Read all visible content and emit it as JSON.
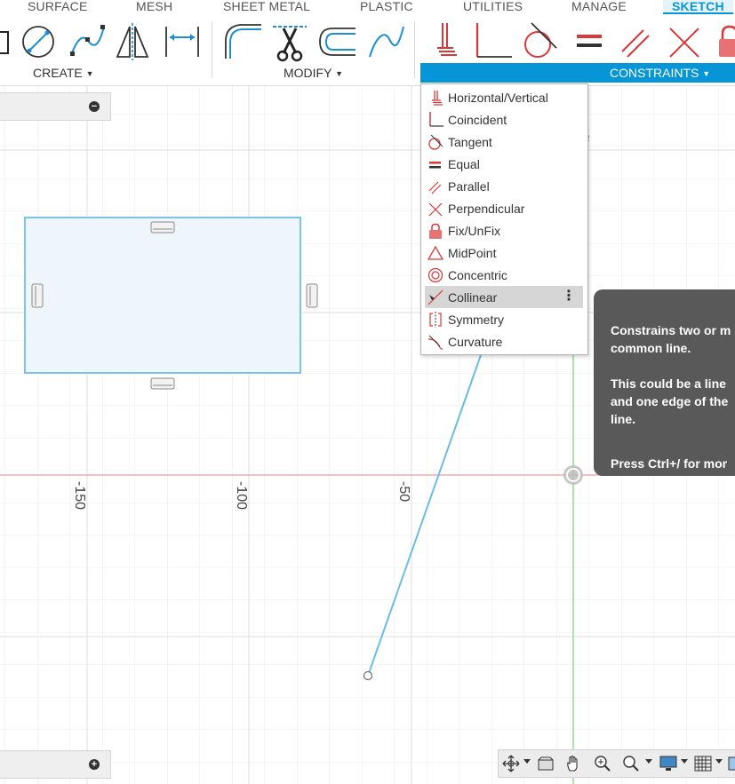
{
  "tabs": {
    "surface": "SURFACE",
    "mesh": "MESH",
    "sheet_metal": "SHEET METAL",
    "plastic": "PLASTIC",
    "utilities": "UTILITIES",
    "manage": "MANAGE",
    "sketch": "SKETCH"
  },
  "groups": {
    "create": "CREATE",
    "modify": "MODIFY",
    "constraints": "CONSTRAINTS"
  },
  "axis_ticks": [
    "-150",
    "-100",
    "-50"
  ],
  "constraints_menu": {
    "items": [
      {
        "label": "Horizontal/Vertical",
        "icon": "horizontal-vertical-icon"
      },
      {
        "label": "Coincident",
        "icon": "coincident-icon"
      },
      {
        "label": "Tangent",
        "icon": "tangent-icon"
      },
      {
        "label": "Equal",
        "icon": "equal-icon"
      },
      {
        "label": "Parallel",
        "icon": "parallel-icon"
      },
      {
        "label": "Perpendicular",
        "icon": "perpendicular-icon"
      },
      {
        "label": "Fix/UnFix",
        "icon": "lock-icon"
      },
      {
        "label": "MidPoint",
        "icon": "midpoint-icon"
      },
      {
        "label": "Concentric",
        "icon": "concentric-icon"
      },
      {
        "label": "Collinear",
        "icon": "collinear-icon"
      },
      {
        "label": "Symmetry",
        "icon": "symmetry-icon"
      },
      {
        "label": "Curvature",
        "icon": "curvature-icon"
      }
    ],
    "highlighted": "Collinear"
  },
  "tooltip": {
    "line1": "Constrains two or m",
    "line2": "common line.",
    "line3": "This could be a line",
    "line4": "and one edge of the",
    "line5": "line.",
    "line6": "Press Ctrl+/ for mor"
  },
  "colors": {
    "accent": "#0696d7",
    "constraint_red": "#d9383a",
    "sketch_line": "#6bbde6",
    "tooltip_bg": "#595959",
    "menu_highlight": "#d6d6d6"
  }
}
